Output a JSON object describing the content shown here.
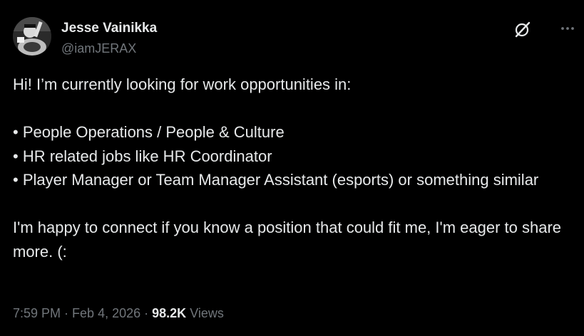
{
  "author": {
    "display_name": "Jesse Vainikka",
    "handle": "@iamJERAX",
    "avatar_icon": "profile-photo-avatar"
  },
  "actions": {
    "grok_icon": "grok-slash-icon",
    "more_icon": "more-dots-icon"
  },
  "post": {
    "intro": "Hi! I’m currently looking for work opportunities in:",
    "bullets": [
      "• People Operations / People & Culture",
      "• HR related jobs like HR Coordinator",
      "• Player Manager or Team Manager Assistant (esports) or something similar"
    ],
    "closing": "I'm happy to connect if you know a position that could fit me, I'm eager to share more. (:"
  },
  "meta": {
    "time": "7:59 PM",
    "separator": "·",
    "date": "Feb 4, 2026",
    "views_count": "98.2K",
    "views_label": "Views"
  },
  "colors": {
    "background": "#000000",
    "primary_text": "#e7e9ea",
    "secondary_text": "#71767b"
  }
}
